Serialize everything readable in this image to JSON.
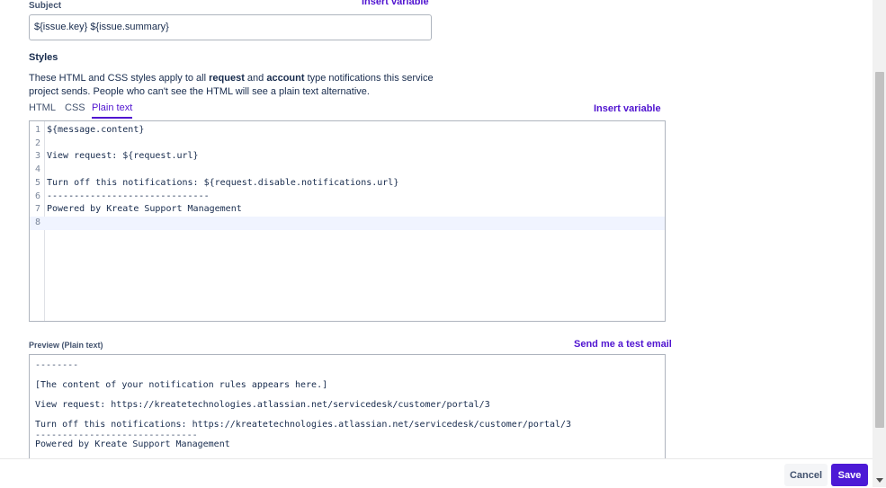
{
  "subject": {
    "label": "Subject",
    "insert_variable": "Insert variable",
    "value": "${issue.key}  ${issue.summary}"
  },
  "styles": {
    "heading": "Styles",
    "desc_prefix": "These HTML and CSS styles apply to all ",
    "desc_bold1": "request",
    "desc_mid": " and ",
    "desc_bold2": "account",
    "desc_suffix": " type notifications this service project sends. People who can't see the HTML will see a plain text alternative."
  },
  "tabs": [
    {
      "label": "HTML",
      "active": false
    },
    {
      "label": "CSS",
      "active": false
    },
    {
      "label": "Plain text",
      "active": true
    }
  ],
  "insert_variable": "Insert variable",
  "editor": {
    "current_line": 8,
    "lines": [
      {
        "n": "1",
        "text": "${message.content}"
      },
      {
        "n": "2",
        "text": ""
      },
      {
        "n": "3",
        "text": "View request: ${request.url}"
      },
      {
        "n": "4",
        "text": ""
      },
      {
        "n": "5",
        "text": "Turn off this notifications: ${request.disable.notifications.url}"
      },
      {
        "n": "6",
        "text": "------------------------------"
      },
      {
        "n": "7",
        "text": "Powered by Kreate Support Management"
      },
      {
        "n": "8",
        "text": ""
      }
    ]
  },
  "preview": {
    "label": "Preview (Plain text)",
    "send_test": "Send me a test email",
    "lines": [
      "--------",
      "[The content of your notification rules appears here.]",
      "View request: https://kreatetechnologies.atlassian.net/servicedesk/customer/portal/3",
      "Turn off this notifications: https://kreatetechnologies.atlassian.net/servicedesk/customer/portal/3",
      "------------------------------",
      "Powered by Kreate Support Management"
    ]
  },
  "footer": {
    "cancel": "Cancel",
    "save": "Save"
  }
}
